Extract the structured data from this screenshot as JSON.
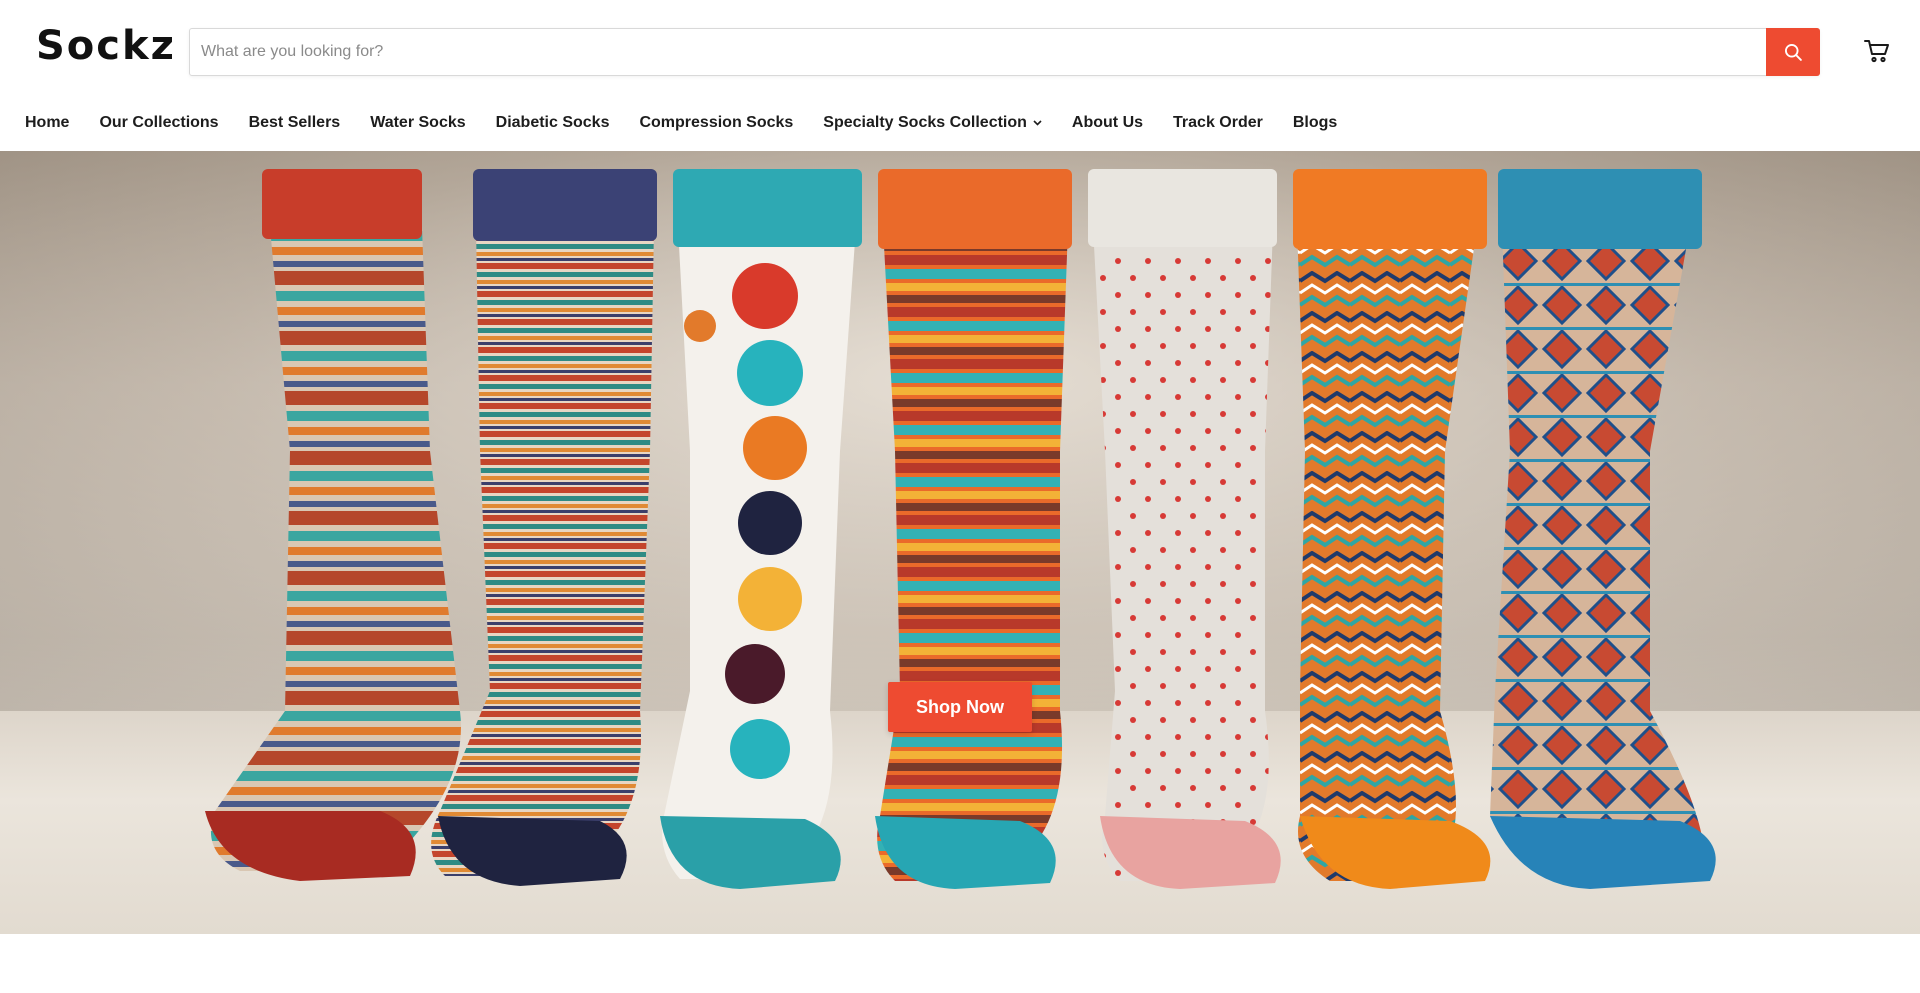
{
  "brand": {
    "logo_text": "Sockz"
  },
  "search": {
    "placeholder": "What are you looking for?",
    "value": "",
    "button_icon": "search-icon"
  },
  "header": {
    "cart_icon": "cart-icon"
  },
  "nav": {
    "items": [
      {
        "label": "Home"
      },
      {
        "label": "Our Collections"
      },
      {
        "label": "Best Sellers"
      },
      {
        "label": "Water Socks"
      },
      {
        "label": "Diabetic Socks"
      },
      {
        "label": "Compression Socks"
      },
      {
        "label": "Specialty Socks Collection",
        "icon": "chevron-down-icon"
      },
      {
        "label": "About Us"
      },
      {
        "label": "Track Order"
      },
      {
        "label": "Blogs"
      }
    ]
  },
  "hero": {
    "cta_label": "Shop Now",
    "image": "row of colorful patterned socks"
  },
  "colors": {
    "accent": "#ee4b31",
    "text": "#1d1d1d",
    "background": "#ffffff"
  }
}
